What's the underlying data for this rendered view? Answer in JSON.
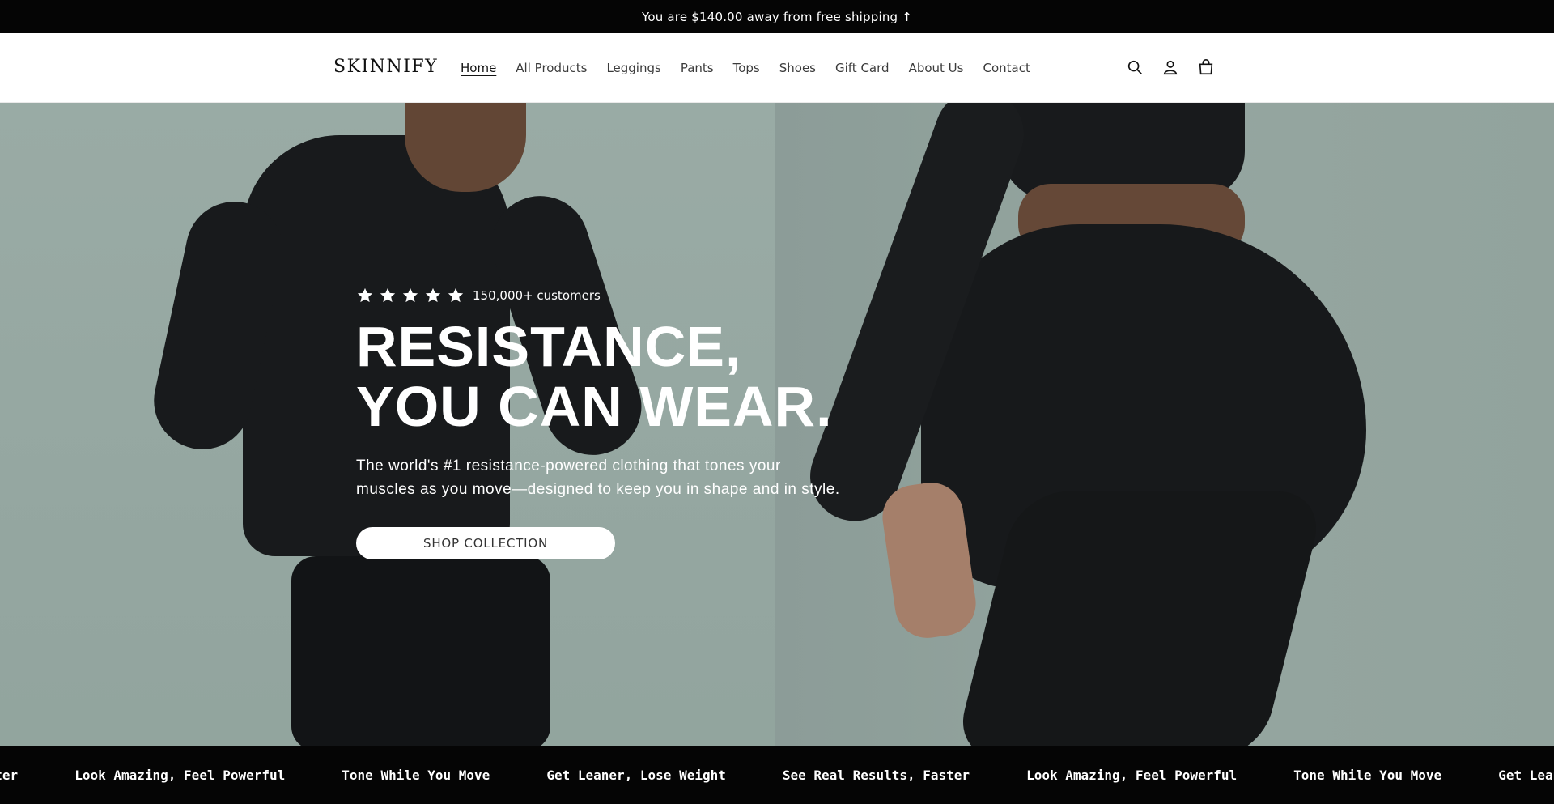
{
  "announcement": {
    "text": "You are $140.00 away from free shipping ↑"
  },
  "header": {
    "logo": "SKINNIFY",
    "nav": [
      {
        "label": "Home",
        "active": true
      },
      {
        "label": "All Products"
      },
      {
        "label": "Leggings"
      },
      {
        "label": "Pants"
      },
      {
        "label": "Tops"
      },
      {
        "label": "Shoes"
      },
      {
        "label": "Gift Card"
      },
      {
        "label": "About Us"
      },
      {
        "label": "Contact"
      }
    ],
    "icons": [
      "search-icon",
      "account-icon",
      "cart-icon"
    ]
  },
  "hero": {
    "rating_stars": 5,
    "rating_text": "150,000+ customers",
    "headline_line1": "RESISTANCE,",
    "headline_line2": "YOU CAN WEAR.",
    "subhead": "The world's #1 resistance-powered clothing that tones your muscles as you move—designed to keep you in shape and in style.",
    "cta_label": "SHOP COLLECTION"
  },
  "marquee": {
    "items": [
      "See Real Results, Faster",
      "Look Amazing, Feel Powerful",
      "Tone While You Move",
      "Get Leaner, Lose Weight",
      "See Real Results, Faster",
      "Look Amazing, Feel Powerful",
      "Tone While You Move",
      "Get Leaner, Lose Weight"
    ]
  },
  "colors": {
    "announce_bg": "#050505",
    "hero_bg": "#a9bcb6",
    "garment": "#1b1d1f",
    "cta_bg": "#ffffff"
  }
}
